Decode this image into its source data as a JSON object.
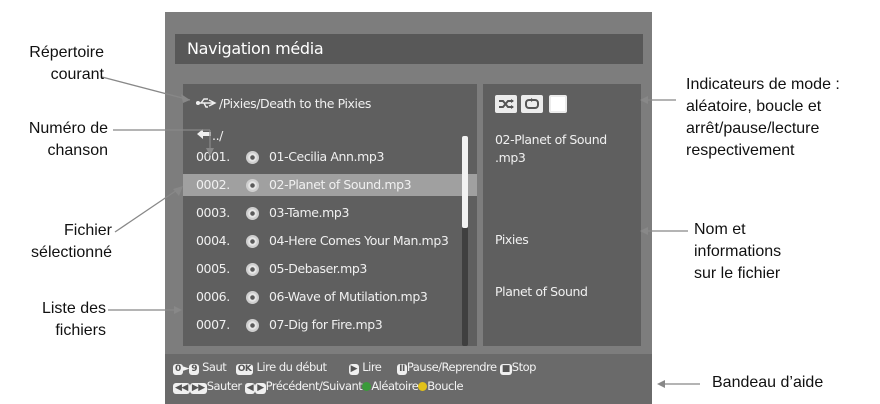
{
  "screen": {
    "title": "Navigation média",
    "path": "/Pixies/Death to the Pixies",
    "updir": "../",
    "files": [
      {
        "num": "0001.",
        "name": "01-Cecilia Ann.mp3"
      },
      {
        "num": "0002.",
        "name": "02-Planet of Sound.mp3"
      },
      {
        "num": "0003.",
        "name": "03-Tame.mp3"
      },
      {
        "num": "0004.",
        "name": "04-Here Comes Your Man.mp3"
      },
      {
        "num": "0005.",
        "name": "05-Debaser.mp3"
      },
      {
        "num": "0006.",
        "name": "06-Wave of Mutilation.mp3"
      },
      {
        "num": "0007.",
        "name": "07-Dig for Fire.mp3"
      }
    ],
    "selected_index": 1,
    "info": {
      "file_line1": "02-Planet of Sound",
      "file_line2": ".mp3",
      "artist": "Pixies",
      "title": "Planet of Sound"
    },
    "help": {
      "key_0": "0",
      "key_9": "9",
      "saut": "Saut",
      "key_ok": "OK",
      "lire_debut": "Lire du début",
      "lire": "Lire",
      "pause": "Pause/Reprendre",
      "stop": "Stop",
      "sauter": "Sauter",
      "prec_suiv": "Précédent/Suivant",
      "aleatoire": "Aléatoire",
      "boucle": "Boucle"
    },
    "colors": {
      "green": "#3a9a3a",
      "yellow": "#e2c21a"
    }
  },
  "callouts": {
    "repertoire": [
      "Répertoire",
      "courant"
    ],
    "numero": [
      "Numéro de",
      "chanson"
    ],
    "fichier": [
      "Fichier",
      "sélectionné"
    ],
    "liste": [
      "Liste des",
      "fichiers"
    ],
    "indicateurs": [
      "Indicateurs de mode :",
      "aléatoire, boucle et",
      "arrêt/pause/lecture",
      "respectivement"
    ],
    "nom": [
      "Nom et",
      "informations",
      "sur le fichier"
    ],
    "bandeau": "Bandeau d’aide"
  }
}
